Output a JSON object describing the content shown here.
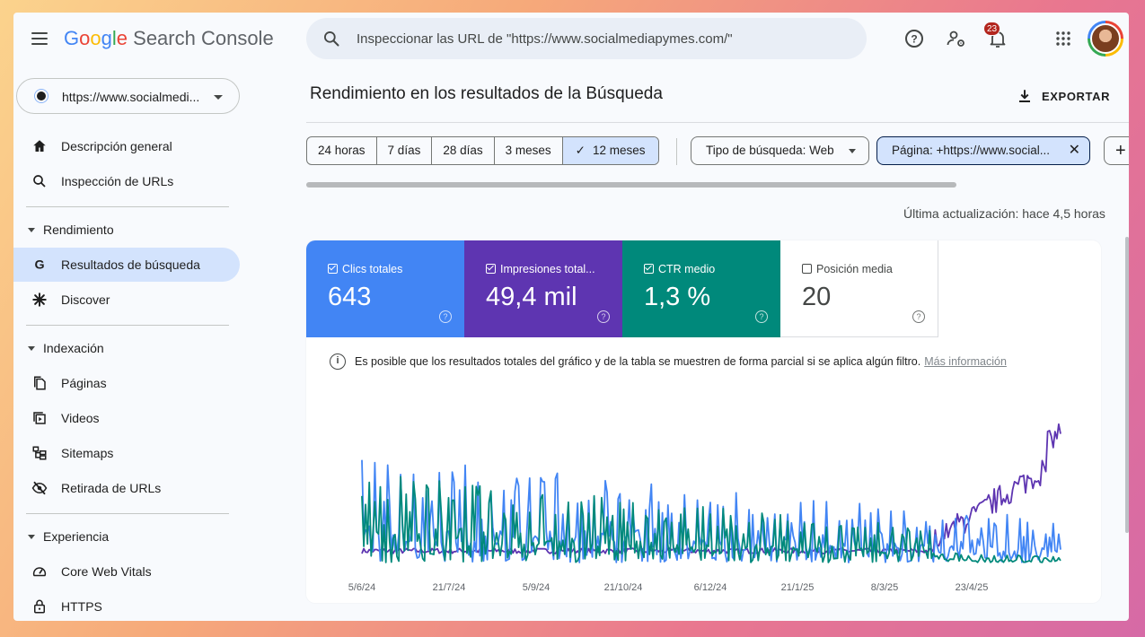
{
  "header": {
    "logo_google": "Google",
    "logo_product": "Search Console",
    "search_placeholder": "Inspeccionar las URL de \"https://www.socialmediapymes.com/\"",
    "notification_count": "23"
  },
  "property": {
    "label": "https://www.socialmedi..."
  },
  "sidebar": {
    "items": [
      {
        "label": "Descripción general",
        "icon": "home-icon"
      },
      {
        "label": "Inspección de URLs",
        "icon": "search-icon"
      },
      {
        "label": "Resultados de búsqueda",
        "icon": "google-g-icon",
        "active": true
      },
      {
        "label": "Discover",
        "icon": "asterisk-icon"
      },
      {
        "label": "Páginas",
        "icon": "pages-icon"
      },
      {
        "label": "Videos",
        "icon": "video-icon"
      },
      {
        "label": "Sitemaps",
        "icon": "sitemap-icon"
      },
      {
        "label": "Retirada de URLs",
        "icon": "eye-off-icon"
      },
      {
        "label": "Core Web Vitals",
        "icon": "gauge-icon"
      },
      {
        "label": "HTTPS",
        "icon": "lock-icon"
      }
    ],
    "sections": [
      "Rendimiento",
      "Indexación",
      "Experiencia"
    ]
  },
  "main": {
    "title": "Rendimiento en los resultados de la Búsqueda",
    "export_label": "EXPORTAR",
    "ranges": [
      "24 horas",
      "7 días",
      "28 días",
      "3 meses",
      "12 meses"
    ],
    "selected_range": "12 meses",
    "filter_type": "Tipo de búsqueda: Web",
    "filter_page": "Página: +https://www.social...",
    "add_filter": "+",
    "last_updated": "Última actualización: hace 4,5 horas",
    "notice": "Es posible que los resultados totales del gráfico y de la tabla se muestren de forma parcial si se aplica algún filtro.",
    "notice_link": "Más información"
  },
  "metrics": [
    {
      "label": "Clics totales",
      "value": "643",
      "checked": true,
      "color": "#4285f4"
    },
    {
      "label": "Impresiones total...",
      "value": "49,4 mil",
      "checked": true,
      "color": "#5e35b1"
    },
    {
      "label": "CTR medio",
      "value": "1,3 %",
      "checked": true,
      "color": "#00897b"
    },
    {
      "label": "Posición media",
      "value": "20",
      "checked": false,
      "color": "#ffffff"
    }
  ],
  "chart_data": {
    "type": "line",
    "x_tick_labels": [
      "5/6/24",
      "21/7/24",
      "5/9/24",
      "21/10/24",
      "6/12/24",
      "21/1/25",
      "8/3/25",
      "23/4/25"
    ],
    "series": [
      {
        "color": "#5e35b1",
        "shape": "low-steady-then-rising"
      },
      {
        "color": "#4285f4",
        "shape": "spiky-decaying"
      },
      {
        "color": "#00897b",
        "shape": "spiky-decaying"
      }
    ],
    "grid": false
  }
}
